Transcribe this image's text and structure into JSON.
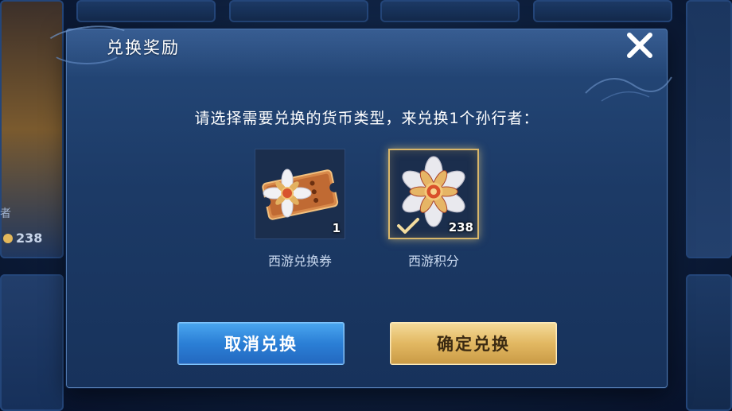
{
  "background": {
    "coin_count": "238",
    "side_text": "者"
  },
  "dialog": {
    "title": "兑换奖励",
    "prompt": "请选择需要兑换的货币类型，来兑换1个孙行者：",
    "close_icon": "close-icon",
    "options": [
      {
        "label": "西游兑换券",
        "count": "1",
        "icon": "ticket-icon",
        "selected": false
      },
      {
        "label": "西游积分",
        "count": "238",
        "icon": "flower-points-icon",
        "selected": true
      }
    ],
    "buttons": {
      "cancel": "取消兑换",
      "confirm": "确定兑换"
    }
  },
  "colors": {
    "panel": "#1c3a66",
    "cancel_button": "#2b7fd6",
    "confirm_button": "#e2b862",
    "selected_border": "#d8b66a"
  }
}
